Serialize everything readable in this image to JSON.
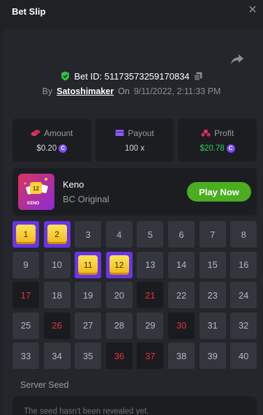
{
  "header": {
    "title": "Bet Slip",
    "close_icon": "close-icon"
  },
  "bet": {
    "id_label": "Bet ID:",
    "id": "51173573259170834",
    "by_label": "By",
    "user": "Satoshimaker",
    "on_label": "On",
    "date": "9/11/2022, 2:11:33 PM"
  },
  "stats": {
    "amount": {
      "label": "Amount",
      "value": "$0.20"
    },
    "payout": {
      "label": "Payout",
      "value": "100 x"
    },
    "profit": {
      "label": "Profit",
      "value": "$20.78"
    }
  },
  "game": {
    "thumb_number": "12",
    "thumb_label": "KENO",
    "name": "Keno",
    "subtitle": "BC Original",
    "play_label": "Play Now"
  },
  "board": {
    "numbers": [
      "1",
      "2",
      "3",
      "4",
      "5",
      "6",
      "7",
      "8",
      "9",
      "10",
      "11",
      "12",
      "13",
      "14",
      "15",
      "16",
      "17",
      "18",
      "19",
      "20",
      "21",
      "22",
      "23",
      "24",
      "25",
      "26",
      "27",
      "28",
      "29",
      "30",
      "31",
      "32",
      "33",
      "34",
      "35",
      "36",
      "37",
      "38",
      "39",
      "40"
    ],
    "picked": [
      1,
      2,
      11,
      12
    ],
    "drawn": [
      17,
      21,
      26,
      30,
      36,
      37
    ]
  },
  "seed": {
    "label": "Server Seed",
    "value": "The seed hasn't been revealed yet."
  },
  "colors": {
    "accent": "#6a35e6",
    "play": "#4bad21",
    "profit": "#2fd05a",
    "hit": "#e5333a",
    "coin": "#7b4cf5"
  }
}
